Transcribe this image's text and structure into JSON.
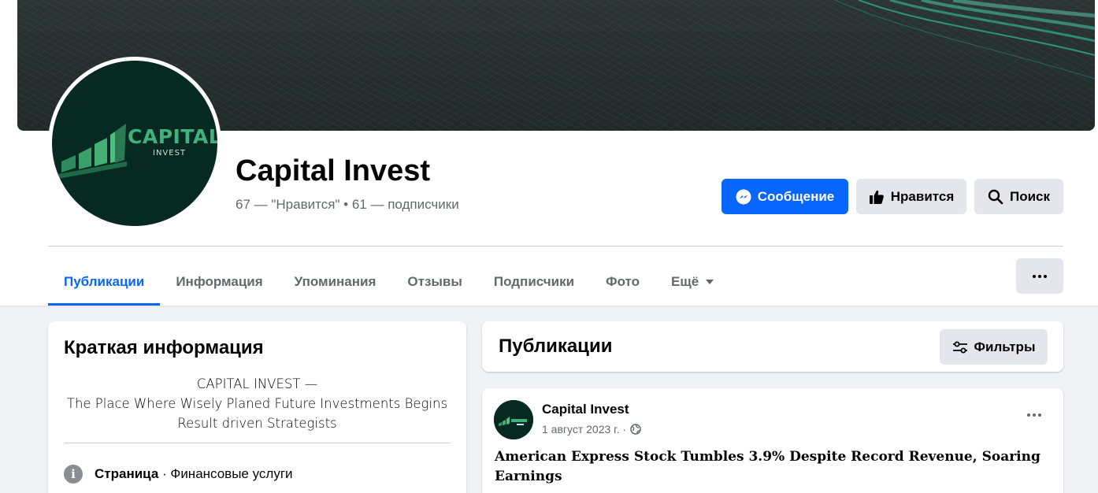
{
  "page": {
    "name": "Capital Invest",
    "stats": "67 — \"Нравится\" • 61 — подписчики",
    "logo_text": "CAPITAL",
    "logo_sub": "INVEST"
  },
  "actions": {
    "message_label": "Сообщение",
    "like_label": "Нравится",
    "search_label": "Поиск"
  },
  "tabs": [
    {
      "label": "Публикации",
      "active": true
    },
    {
      "label": "Информация"
    },
    {
      "label": "Упоминания"
    },
    {
      "label": "Отзывы"
    },
    {
      "label": "Подписчики"
    },
    {
      "label": "Фото"
    },
    {
      "label": "Ещё"
    }
  ],
  "intro": {
    "title": "Краткая информация",
    "bio_lines": [
      "CAPITAL INVEST —",
      "The Place Where Wisely Planed Future Investments Begins",
      "Result driven Strategists"
    ],
    "category_label": "Страница",
    "category_value": " · Финансовые услуги"
  },
  "posts": {
    "title": "Публикации",
    "filter_label": "Фильтры",
    "items": [
      {
        "author": "Capital Invest",
        "date": "1 август 2023 г. ·",
        "text": "American Express Stock Tumbles 3.9% Despite Record Revenue, Soaring Earnings"
      }
    ]
  },
  "colors": {
    "accent": "#0866ff",
    "secondary_button": "#e4e6eb",
    "muted_text": "#65676b",
    "logo_bg": "#062a21"
  }
}
